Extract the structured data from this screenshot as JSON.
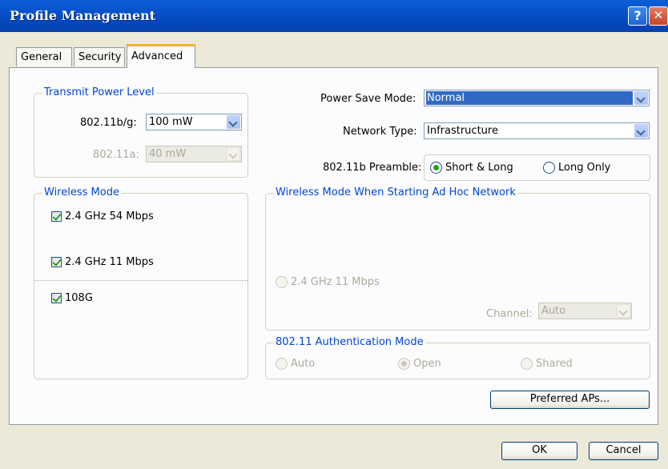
{
  "window": {
    "title": "Profile Management",
    "help_button": "?",
    "close_button": "✕"
  },
  "tabs": [
    {
      "label": "General",
      "active": false
    },
    {
      "label": "Security",
      "active": false
    },
    {
      "label": "Advanced",
      "active": true
    }
  ],
  "transmit_power": {
    "legend": "Transmit Power Level",
    "bg_label": "802.11b/g:",
    "bg_value": "100 mW",
    "a_label": "802.11a:",
    "a_value": "40 mW"
  },
  "wireless_mode": {
    "legend": "Wireless Mode",
    "options": [
      {
        "label": "2.4 GHz 54 Mbps",
        "checked": true
      },
      {
        "label": "2.4 GHz 11 Mbps",
        "checked": true
      },
      {
        "label": "108G",
        "checked": true
      }
    ]
  },
  "power_save": {
    "label": "Power Save Mode:",
    "value": "Normal"
  },
  "network_type": {
    "label": "Network Type:",
    "value": "Infrastructure"
  },
  "preamble": {
    "label": "802.11b Preamble:",
    "options": [
      {
        "label": "Short & Long",
        "selected": true
      },
      {
        "label": "Long Only",
        "selected": false
      }
    ]
  },
  "adhoc": {
    "legend": "Wireless Mode When Starting Ad Hoc Network",
    "option": "2.4 GHz 11 Mbps",
    "channel_label": "Channel:",
    "channel_value": "Auto"
  },
  "auth": {
    "legend": "802.11 Authentication Mode",
    "options": [
      {
        "label": "Auto",
        "selected": false
      },
      {
        "label": "Open",
        "selected": true
      },
      {
        "label": "Shared",
        "selected": false
      }
    ]
  },
  "buttons": {
    "preferred_aps": "Preferred APs...",
    "ok": "OK",
    "cancel": "Cancel"
  }
}
